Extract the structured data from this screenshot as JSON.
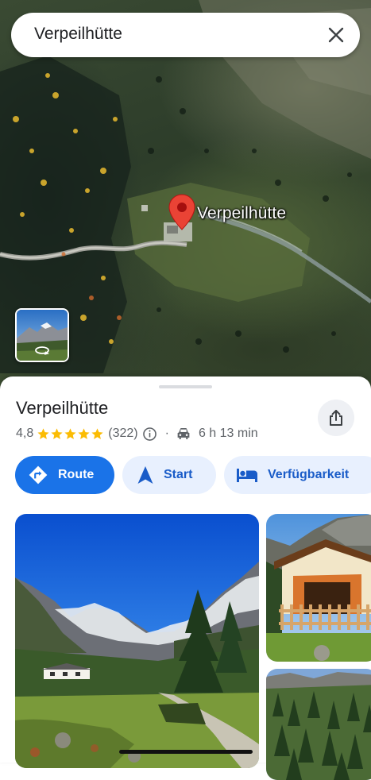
{
  "search": {
    "query": "Verpeilhütte"
  },
  "map": {
    "pin_label": "Verpeilhütte"
  },
  "place": {
    "title": "Verpeilhütte",
    "rating": "4,8",
    "stars": 5,
    "review_count": "(322)",
    "separator": "·",
    "drive_time": "6 h 13 min"
  },
  "actions": {
    "route_label": "Route",
    "start_label": "Start",
    "availability_label": "Verfügbarkeit"
  },
  "icons": {
    "close": "close-icon",
    "share": "share-icon",
    "info": "info-icon",
    "car": "car-icon",
    "route": "directions-icon",
    "start": "navigation-arrow-icon",
    "availability": "bed-icon",
    "street_view": "360-view-icon",
    "pin": "map-pin-icon"
  },
  "colors": {
    "accent": "#1a73e8",
    "accent_light": "#e8f0fe",
    "star": "#fbbc04",
    "pin": "#ea4335"
  }
}
